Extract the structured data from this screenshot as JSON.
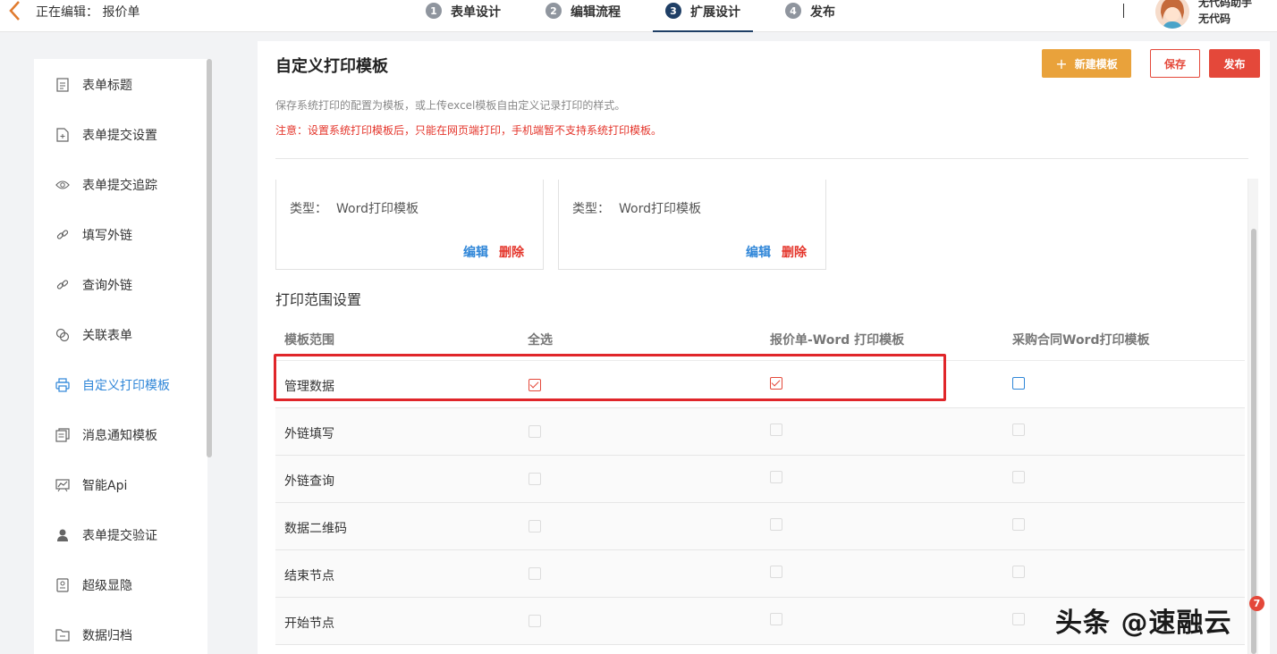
{
  "header": {
    "editing_label": "正在编辑：",
    "doc_name": "报价单",
    "steps": [
      {
        "num": "1",
        "label": "表单设计"
      },
      {
        "num": "2",
        "label": "编辑流程"
      },
      {
        "num": "3",
        "label": "扩展设计"
      },
      {
        "num": "4",
        "label": "发布"
      }
    ],
    "active_step": 3,
    "user": {
      "name": "无代码助手",
      "role": "无代码"
    }
  },
  "sidebar": {
    "items": [
      {
        "label": "表单标题",
        "icon": "document-icon"
      },
      {
        "label": "表单提交设置",
        "icon": "file-plus-icon"
      },
      {
        "label": "表单提交追踪",
        "icon": "eye-icon"
      },
      {
        "label": "填写外链",
        "icon": "link-icon"
      },
      {
        "label": "查询外链",
        "icon": "link-icon"
      },
      {
        "label": "关联表单",
        "icon": "chain-icon"
      },
      {
        "label": "自定义打印模板",
        "icon": "printer-icon"
      },
      {
        "label": "消息通知模板",
        "icon": "message-icon"
      },
      {
        "label": "智能Api",
        "icon": "presentation-icon"
      },
      {
        "label": "表单提交验证",
        "icon": "user-icon"
      },
      {
        "label": "超级显隐",
        "icon": "toggle-icon"
      },
      {
        "label": "数据归档",
        "icon": "archive-icon"
      }
    ],
    "active_index": 6
  },
  "main": {
    "title": "自定义打印模板",
    "buttons": {
      "new_template": "新建模板",
      "save": "保存",
      "publish": "发布"
    },
    "description": "保存系统打印的配置为模板，或上传excel模板自由定义记录打印的样式。",
    "notice": "注意：设置系统打印模板后，只能在网页端打印，手机端暂不支持系统打印模板。",
    "cards": [
      {
        "type_label": "类型：",
        "type_value": "Word打印模板",
        "edit": "编辑",
        "delete": "删除"
      },
      {
        "type_label": "类型：",
        "type_value": "Word打印模板",
        "edit": "编辑",
        "delete": "删除"
      }
    ],
    "section_title": "打印范围设置",
    "table": {
      "headers": [
        "模板范围",
        "全选",
        "报价单-Word 打印模板",
        "采购合同Word打印模板"
      ],
      "rows": [
        {
          "label": "管理数据",
          "select_all": true,
          "quote_word": true,
          "contract_word": false
        },
        {
          "label": "外链填写",
          "select_all": false,
          "quote_word": false,
          "contract_word": false
        },
        {
          "label": "外链查询",
          "select_all": false,
          "quote_word": false,
          "contract_word": false
        },
        {
          "label": "数据二维码",
          "select_all": false,
          "quote_word": false,
          "contract_word": false
        },
        {
          "label": "结束节点",
          "select_all": false,
          "quote_word": false,
          "contract_word": false
        },
        {
          "label": "开始节点",
          "select_all": false,
          "quote_word": false,
          "contract_word": false
        }
      ]
    }
  },
  "watermark": {
    "text": "头条 @速融云",
    "badge": "7"
  },
  "colors": {
    "accent_blue": "#2f86d8",
    "danger_red": "#e4483a",
    "orange": "#e9a23b",
    "step_active": "#1f3f66"
  }
}
